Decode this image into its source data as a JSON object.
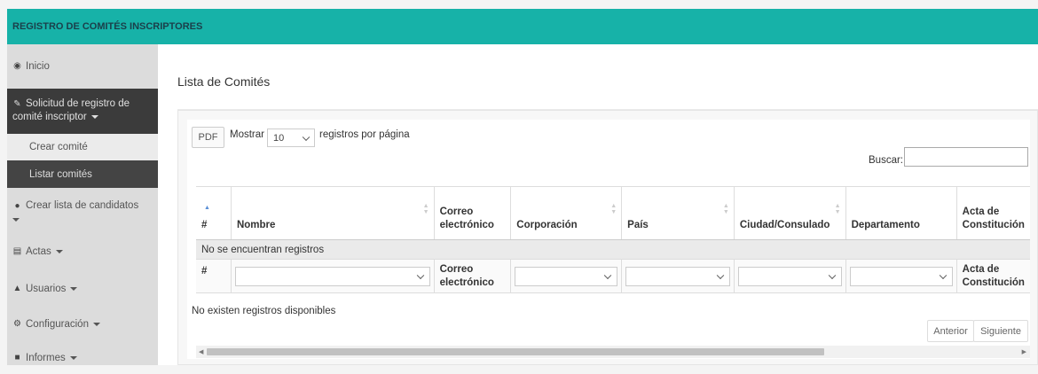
{
  "app": {
    "title": "REGISTRO DE COMITÉS INSCRIPTORES"
  },
  "sidebar": {
    "items": [
      {
        "label": "Inicio",
        "icon": "tachometer-icon"
      },
      {
        "label": "Solicitud de registro de",
        "label2": "comité inscriptor",
        "icon": "edit-icon"
      },
      {
        "label": "Crear comité"
      },
      {
        "label": "Listar comités"
      },
      {
        "label": "Crear lista de candidatos",
        "icon": "users-icon"
      },
      {
        "label": "Actas",
        "icon": "file-icon"
      },
      {
        "label": "Usuarios",
        "icon": "user-icon"
      },
      {
        "label": "Configuración",
        "icon": "gear-icon"
      },
      {
        "label": "Informes",
        "icon": "book-icon"
      }
    ]
  },
  "main": {
    "title": "Lista de Comités",
    "pdf_label": "PDF",
    "show_label": "Mostrar",
    "page_size": "10",
    "per_page_label": "registros por página",
    "search_label": "Buscar:",
    "search_value": "",
    "columns": [
      "#",
      "Nombre",
      "Correo electrónico",
      "Corporación",
      "País",
      "Ciudad/Consulado",
      "Departamento",
      "Acta de Constitución"
    ],
    "empty_message": "No se encuentran registros",
    "footer": {
      "hash": "#",
      "email": "Correo electrónico",
      "acta": "Acta de Constitución"
    },
    "info": "No existen registros disponibles",
    "prev_label": "Anterior",
    "next_label": "Siguiente"
  },
  "colors": {
    "topbar": "#17b2a8",
    "sidebar": "#dcdcdc",
    "sidebar_active": "#3b3b3b"
  }
}
